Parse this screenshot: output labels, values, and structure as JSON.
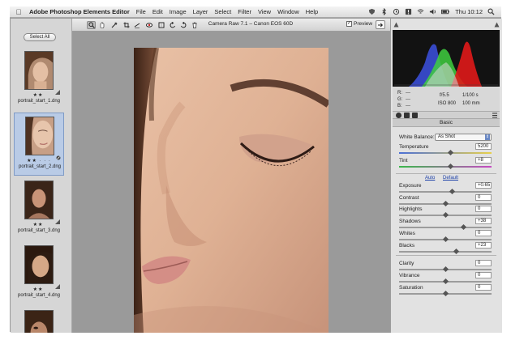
{
  "menubar": {
    "app_name": "Adobe Photoshop Elements Editor",
    "items": [
      "File",
      "Edit",
      "Image",
      "Layer",
      "Select",
      "Filter",
      "View",
      "Window",
      "Help"
    ],
    "clock": "Thu 10:12"
  },
  "filmstrip": {
    "select_all_label": "Select All",
    "thumbs": [
      {
        "name": "portrait_start_1.dng",
        "stars": "★★"
      },
      {
        "name": "portrait_start_2.dng",
        "stars": "★★ · · ·"
      },
      {
        "name": "portrait_start_3.dng",
        "stars": "★★"
      },
      {
        "name": "portrait_start_4.dng",
        "stars": "★★"
      }
    ]
  },
  "toolbar": {
    "title": "Camera Raw 7.1  –  Canon EOS 60D",
    "preview_label": "Preview",
    "preview_checked": true
  },
  "camera_info": {
    "r_label": "R:",
    "g_label": "G:",
    "b_label": "B:",
    "r_value": "---",
    "g_value": "---",
    "b_value": "---",
    "aperture": "f/5.5",
    "shutter": "1/100 s",
    "iso": "ISO 800",
    "focal": "100 mm"
  },
  "panel": {
    "section_title": "Basic",
    "white_balance_label": "White Balance:",
    "white_balance_value": "As Shot",
    "auto_label": "Auto",
    "default_label": "Default",
    "controls": {
      "temperature": {
        "label": "Temperature",
        "value": "5200",
        "level": 0.55
      },
      "tint": {
        "label": "Tint",
        "value": "+8",
        "level": 0.55
      },
      "exposure": {
        "label": "Exposure",
        "value": "+0.65",
        "level": 0.57
      },
      "contrast": {
        "label": "Contrast",
        "value": "0",
        "level": 0.5
      },
      "highlights": {
        "label": "Highlights",
        "value": "0",
        "level": 0.5
      },
      "shadows": {
        "label": "Shadows",
        "value": "+38",
        "level": 0.69
      },
      "whites": {
        "label": "Whites",
        "value": "0",
        "level": 0.5
      },
      "blacks": {
        "label": "Blacks",
        "value": "+23",
        "level": 0.61
      },
      "clarity": {
        "label": "Clarity",
        "value": "0",
        "level": 0.5
      },
      "vibrance": {
        "label": "Vibrance",
        "value": "0",
        "level": 0.5
      },
      "saturation": {
        "label": "Saturation",
        "value": "0",
        "level": 0.5
      }
    }
  },
  "colors": {
    "accent": "#6a88c4",
    "selection": "#b9cbe6",
    "histogram_red": "#e01a1a",
    "histogram_green": "#3fcf3f",
    "histogram_blue": "#3a4ed6"
  }
}
